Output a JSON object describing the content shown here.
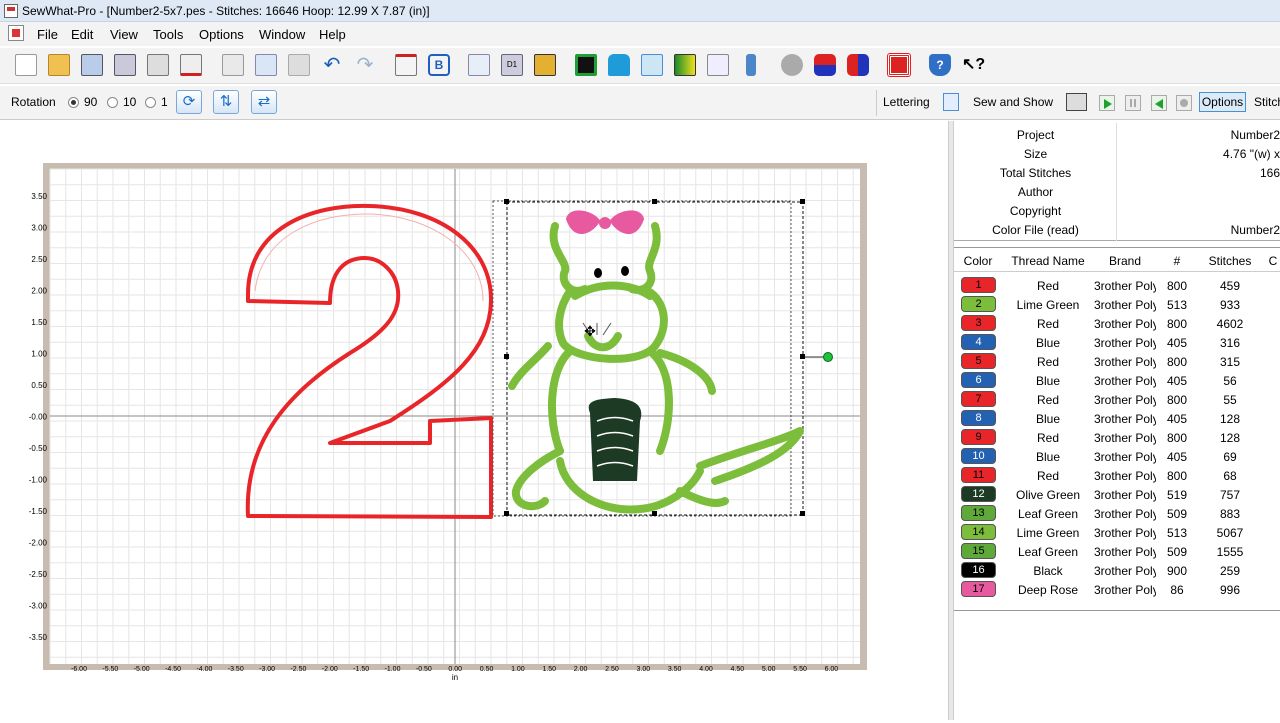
{
  "window": {
    "title": "SewWhat-Pro - [Number2-5x7.pes - Stitches: 16646  Hoop: 12.99 X 7.87 (in)]"
  },
  "menu": [
    "File",
    "Edit",
    "View",
    "Tools",
    "Options",
    "Window",
    "Help"
  ],
  "toolbar_icons": [
    "new-file-icon",
    "open-folder-icon",
    "save-icon",
    "save-as-icon",
    "print-icon",
    "print-preview-icon",
    "cut-icon",
    "copy-icon",
    "paste-icon",
    "undo-icon",
    "redo-icon",
    "stitch-tool-icon",
    "b-icon",
    "pages-icon",
    "d1-icon",
    "design-icon",
    "hoop-green-icon",
    "shirt-icon",
    "frame-icon",
    "color-gradient-icon",
    "grid-cut-icon",
    "pin-icon",
    "spool-icon",
    "red-blue-icon",
    "red-blue-2-icon",
    "grid-red-icon",
    "help-shield-icon",
    "whats-this-icon"
  ],
  "optbar": {
    "rotation_label": "Rotation",
    "rot_options": [
      "90",
      "10",
      "1"
    ],
    "selected_rotation": "90",
    "lettering": "Lettering",
    "sew_and_show": "Sew and Show",
    "options": "Options",
    "stitch": "Stitch"
  },
  "properties": [
    {
      "k": "Project",
      "v": "Number2"
    },
    {
      "k": "Size",
      "v": "4.76 \"(w) x"
    },
    {
      "k": "Total Stitches",
      "v": "166"
    },
    {
      "k": "Author",
      "v": ""
    },
    {
      "k": "Copyright",
      "v": ""
    },
    {
      "k": "Color File (read)",
      "v": "Number2"
    }
  ],
  "table": {
    "headers": [
      "Color",
      "Thread Name",
      "Brand",
      "#",
      "Stitches",
      "C"
    ],
    "rows": [
      {
        "n": "1",
        "color": "#e8262a",
        "name": "Red",
        "brand": "3rother Poly",
        "num": "800",
        "st": "459"
      },
      {
        "n": "2",
        "color": "#7cbe3c",
        "name": "Lime Green",
        "brand": "3rother Poly",
        "num": "513",
        "st": "933"
      },
      {
        "n": "3",
        "color": "#e8262a",
        "name": "Red",
        "brand": "3rother Poly",
        "num": "800",
        "st": "4602"
      },
      {
        "n": "4",
        "color": "#2361b3",
        "name": "Blue",
        "brand": "3rother Poly",
        "num": "405",
        "st": "316"
      },
      {
        "n": "5",
        "color": "#e8262a",
        "name": "Red",
        "brand": "3rother Poly",
        "num": "800",
        "st": "315"
      },
      {
        "n": "6",
        "color": "#2361b3",
        "name": "Blue",
        "brand": "3rother Poly",
        "num": "405",
        "st": "56"
      },
      {
        "n": "7",
        "color": "#e8262a",
        "name": "Red",
        "brand": "3rother Poly",
        "num": "800",
        "st": "55"
      },
      {
        "n": "8",
        "color": "#2361b3",
        "name": "Blue",
        "brand": "3rother Poly",
        "num": "405",
        "st": "128"
      },
      {
        "n": "9",
        "color": "#e8262a",
        "name": "Red",
        "brand": "3rother Poly",
        "num": "800",
        "st": "128"
      },
      {
        "n": "10",
        "color": "#2361b3",
        "name": "Blue",
        "brand": "3rother Poly",
        "num": "405",
        "st": "69"
      },
      {
        "n": "11",
        "color": "#e8262a",
        "name": "Red",
        "brand": "3rother Poly",
        "num": "800",
        "st": "68"
      },
      {
        "n": "12",
        "color": "#1d3a25",
        "name": "Olive Green",
        "brand": "3rother Poly",
        "num": "519",
        "st": "757"
      },
      {
        "n": "13",
        "color": "#5fa83a",
        "name": "Leaf Green",
        "brand": "3rother Poly",
        "num": "509",
        "st": "883"
      },
      {
        "n": "14",
        "color": "#7cbe3c",
        "name": "Lime Green",
        "brand": "3rother Poly",
        "num": "513",
        "st": "5067"
      },
      {
        "n": "15",
        "color": "#5fa83a",
        "name": "Leaf Green",
        "brand": "3rother Poly",
        "num": "509",
        "st": "1555"
      },
      {
        "n": "16",
        "color": "#000000",
        "name": "Black",
        "brand": "3rother Poly",
        "num": "900",
        "st": "259"
      },
      {
        "n": "17",
        "color": "#e85aa0",
        "name": "Deep Rose",
        "brand": "3rother Poly",
        "num": "86",
        "st": "996"
      }
    ]
  },
  "canvas": {
    "y_ticks": [
      "3.50",
      "3.00",
      "2.50",
      "2.00",
      "1.50",
      "1.00",
      "0.50",
      "-0.00",
      "-0.50",
      "-1.00",
      "-1.50",
      "-2.00",
      "-2.50",
      "-3.00",
      "-3.50"
    ],
    "x_ticks": [
      "-6.00",
      "-5.50",
      "-5.00",
      "-4.50",
      "-4.00",
      "-3.50",
      "-3.00",
      "-2.50",
      "-2.00",
      "-1.50",
      "-1.00",
      "-0.50",
      "0.00",
      "0.50",
      "1.00",
      "1.50",
      "2.00",
      "2.50",
      "3.00",
      "3.50",
      "4.00",
      "4.50",
      "5.00",
      "5.50",
      "6.00"
    ],
    "unit": "in"
  },
  "colors": {
    "red": "#e8262a",
    "lime": "#7cbe3c",
    "dark": "#1d3a25",
    "rose": "#e85aa0",
    "hoop": "#c8bcb0"
  }
}
